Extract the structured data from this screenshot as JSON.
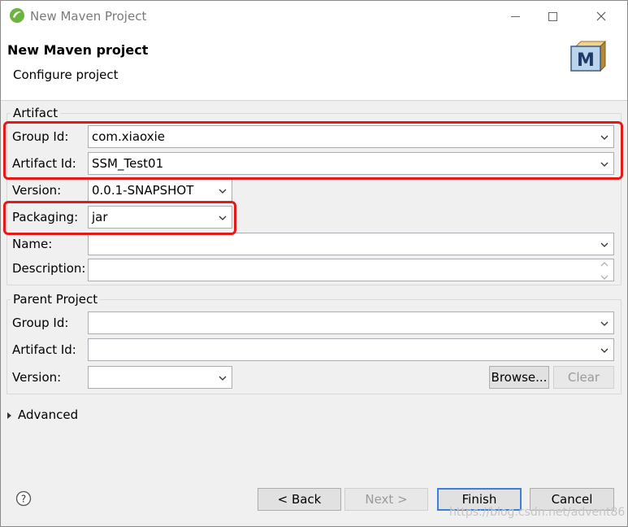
{
  "window": {
    "title": "New Maven Project",
    "minimize_icon": "minimize-icon",
    "maximize_icon": "maximize-icon",
    "close_icon": "close-icon"
  },
  "header": {
    "title": "New Maven project",
    "subtitle": "Configure project",
    "icon": "maven-m-icon"
  },
  "artifact": {
    "legend": "Artifact",
    "group_id_label": "Group Id:",
    "group_id_value": "com.xiaoxie",
    "artifact_id_label": "Artifact Id:",
    "artifact_id_value": "SSM_Test01",
    "version_label": "Version:",
    "version_value": "0.0.1-SNAPSHOT",
    "packaging_label": "Packaging:",
    "packaging_value": "jar",
    "name_label": "Name:",
    "name_value": "",
    "description_label": "Description:",
    "description_value": ""
  },
  "parent": {
    "legend": "Parent Project",
    "group_id_label": "Group Id:",
    "group_id_value": "",
    "artifact_id_label": "Artifact Id:",
    "artifact_id_value": "",
    "version_label": "Version:",
    "version_value": "",
    "browse_label": "Browse...",
    "clear_label": "Clear"
  },
  "advanced": {
    "label": "Advanced"
  },
  "footer": {
    "help_icon": "help-icon",
    "back_label": "< Back",
    "next_label": "Next >",
    "finish_label": "Finish",
    "cancel_label": "Cancel"
  },
  "watermark": "https://blog.csdn.net/advent86",
  "colors": {
    "highlight": "#e21a1a",
    "default_button_border": "#3c7fd6",
    "dialog_bg": "#f0f0f0"
  }
}
